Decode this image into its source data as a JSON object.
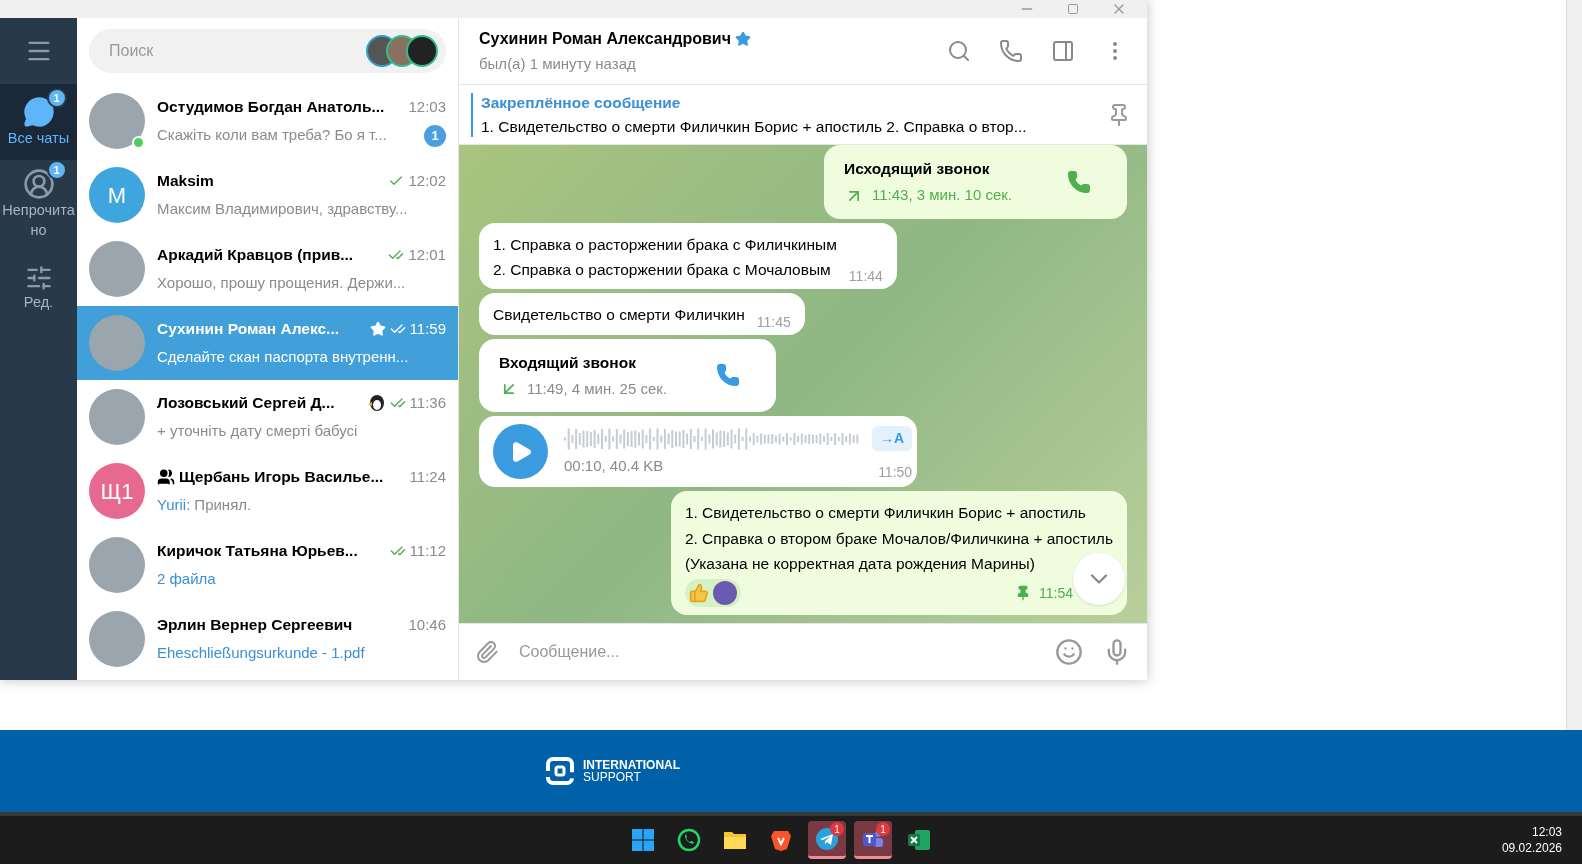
{
  "window": {
    "controls": [
      {
        "kind": "minimize"
      },
      {
        "kind": "maximize"
      },
      {
        "kind": "close"
      }
    ]
  },
  "sidebar": {
    "items": [
      {
        "kind": "chats",
        "label": "Все чаты",
        "badge": "1",
        "selected": true
      },
      {
        "kind": "unread",
        "label": "Непрочитано",
        "badge": "1",
        "selected": false
      },
      {
        "kind": "edit",
        "label": "Ред.",
        "selected": false
      }
    ]
  },
  "search": {
    "placeholder": "Поиск"
  },
  "chats": [
    {
      "name": "Остудимов Богдан Анатоль...",
      "time": "12:03",
      "preview": "Скажіть коли вам треба? Бо я т...",
      "avatar": {
        "kind": "photo"
      },
      "online": true,
      "unread": "1",
      "selected": false
    },
    {
      "name": "Maksim",
      "time": "12:02",
      "preview": "Максим Владимирович, здравству...",
      "avatar": {
        "kind": "letter",
        "initials": "M",
        "color": "#3ea6dc"
      },
      "read": false,
      "selected": false
    },
    {
      "name": "Аркадий Кравцов (прив...",
      "time": "12:01",
      "preview": "Хорошо, прошу прощения. Держи...",
      "avatar": {
        "kind": "photo"
      },
      "read": true,
      "selected": false
    },
    {
      "name": "Сухинин Роман Алекс...",
      "time": "11:59",
      "preview": "Сделайте скан паспорта внутренн...",
      "avatar": {
        "kind": "photo"
      },
      "read": true,
      "starred": true,
      "selected": true
    },
    {
      "name": "Лозовський Сергей Д...",
      "time": "11:36",
      "preview": "+ уточніть дату смерті бабусі",
      "avatar": {
        "kind": "photo"
      },
      "read": true,
      "emoji_status": true,
      "selected": false
    },
    {
      "name": "Щербань Игорь Василье...",
      "time": "11:24",
      "sender": "Yurii:",
      "preview": "Принял.",
      "avatar": {
        "kind": "letter",
        "initials": "Щ1",
        "color": "#e8698f"
      },
      "group": true,
      "selected": false
    },
    {
      "name": "Киричок Татьяна Юрьев...",
      "time": "11:12",
      "preview": "2 файла",
      "attachment": true,
      "avatar": {
        "kind": "photo"
      },
      "read": true,
      "selected": false
    },
    {
      "name": "Эрлин Вернер Сергеевич",
      "time": "10:46",
      "preview": "Eheschließungsurkunde - 1.pdf",
      "attachment": true,
      "avatar": {
        "kind": "photo"
      },
      "selected": false
    }
  ],
  "chat": {
    "title": "Сухинин Роман Александрович",
    "starred": true,
    "status": "был(а) 1 минуту назад",
    "pinned": {
      "label": "Закреплённое сообщение",
      "text": "1. Свидетельство о смерти Филичкин Борис + апостиль 2. Справка о втор..."
    },
    "messages": [
      {
        "kind": "call",
        "outgoing": true,
        "title": "Исходящий звонок",
        "details": "11:43, 3 мин. 10 сек."
      },
      {
        "kind": "text",
        "outgoing": false,
        "lines": [
          "1. Справка о расторжении брака с Филичкиным",
          "2. Справка о расторжении брака  с Мочаловым"
        ],
        "time": "11:44"
      },
      {
        "kind": "text",
        "outgoing": false,
        "lines": [
          "Свидетельство о смерти Филичкин"
        ],
        "time": "11:45"
      },
      {
        "kind": "call",
        "outgoing": false,
        "title": "Входящий звонок",
        "details": "11:49, 4 мин. 25 сек."
      },
      {
        "kind": "voice",
        "outgoing": false,
        "info": "00:10, 40.4 KB",
        "transcribe": "→A",
        "time": "11:50"
      },
      {
        "kind": "text",
        "outgoing": true,
        "lines": [
          "1. Свидетельство о смерти Филичкин Борис + апостиль",
          "2. Справка о втором браке Мочалов/Филичкина + апостиль",
          "(Указана не корректная дата рождения Марины)"
        ],
        "time": "11:54",
        "pinned": true,
        "reaction": true
      }
    ],
    "composer": {
      "placeholder": "Сообщение..."
    }
  },
  "banner": {
    "logo_lines": [
      "INTERNATIONAL",
      "SUPPORT"
    ]
  },
  "taskbar": {
    "apps": [
      {
        "kind": "start",
        "active": false
      },
      {
        "kind": "whatsapp",
        "active": false
      },
      {
        "kind": "folder",
        "active": false
      },
      {
        "kind": "brave",
        "active": false
      },
      {
        "kind": "telegram",
        "active": true,
        "badge": "1"
      },
      {
        "kind": "teams",
        "active": true,
        "badge": "1"
      },
      {
        "kind": "excel",
        "active": false
      }
    ],
    "time": "12:03",
    "date": "09.02.2026"
  }
}
